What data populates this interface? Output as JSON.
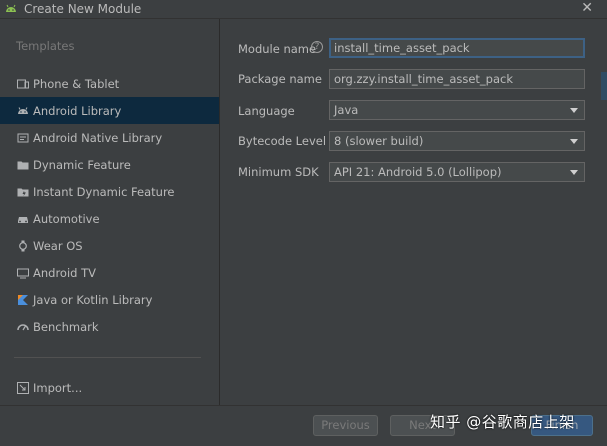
{
  "window": {
    "title": "Create New Module",
    "close_glyph": "✕"
  },
  "sidebar": {
    "section_title": "Templates",
    "items": [
      {
        "label": "Phone & Tablet",
        "icon": "phone-tablet-icon",
        "selected": false
      },
      {
        "label": "Android Library",
        "icon": "android-icon",
        "selected": true
      },
      {
        "label": "Android Native Library",
        "icon": "native-library-icon",
        "selected": false
      },
      {
        "label": "Dynamic Feature",
        "icon": "folder-icon",
        "selected": false
      },
      {
        "label": "Instant Dynamic Feature",
        "icon": "instant-folder-icon",
        "selected": false
      },
      {
        "label": "Automotive",
        "icon": "car-icon",
        "selected": false
      },
      {
        "label": "Wear OS",
        "icon": "watch-icon",
        "selected": false
      },
      {
        "label": "Android TV",
        "icon": "tv-icon",
        "selected": false
      },
      {
        "label": "Java or Kotlin Library",
        "icon": "kotlin-icon",
        "selected": false
      },
      {
        "label": "Benchmark",
        "icon": "gauge-icon",
        "selected": false
      }
    ],
    "import_label": "Import..."
  },
  "form": {
    "module_name": {
      "label": "Module name",
      "value": "install_time_asset_pack"
    },
    "package_name": {
      "label": "Package name",
      "value": "org.zzy.install_time_asset_pack"
    },
    "language": {
      "label": "Language",
      "value": "Java"
    },
    "bytecode_level": {
      "label": "Bytecode Level",
      "value": "8 (slower build)"
    },
    "minimum_sdk": {
      "label": "Minimum SDK",
      "value": "API 21: Android 5.0 (Lollipop)"
    },
    "help_glyph": "?"
  },
  "buttons": {
    "previous": "Previous",
    "next": "Next",
    "finish": "Finish"
  },
  "watermark": "知乎 @谷歌商店上架",
  "colors": {
    "accent": "#365880",
    "selection": "#0d293e",
    "android_green": "#8cc152"
  }
}
